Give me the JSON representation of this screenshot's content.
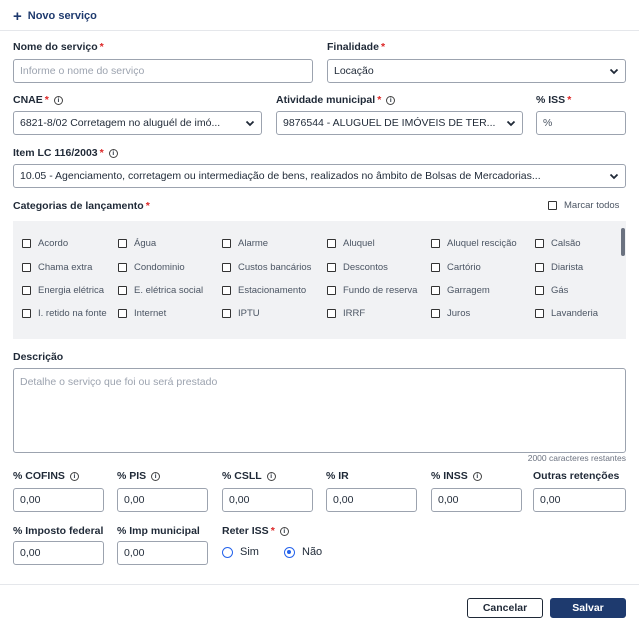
{
  "header": {
    "new_service": "Novo serviço"
  },
  "service_name": {
    "label": "Nome do serviço",
    "required": "*",
    "placeholder": "Informe o nome do serviço"
  },
  "purpose": {
    "label": "Finalidade",
    "required": " *",
    "value": "Locação"
  },
  "cnae": {
    "label": "CNAE",
    "required": "*",
    "value": "6821-8/02 Corretagem no aluguél de imó..."
  },
  "municipal_activity": {
    "label": "Atividade municipal",
    "required": "*",
    "value": "9876544 - ALUGUEL DE IMÓVEIS DE TER..."
  },
  "iss": {
    "label": "% ISS",
    "required": "*",
    "placeholder": "%"
  },
  "item_lc": {
    "label": "Item LC 116/2003",
    "required": " *",
    "value": "10.05 - Agenciamento, corretagem ou intermediação de bens, realizados no âmbito de Bolsas de Mercadorias..."
  },
  "categories": {
    "label": "Categorias de lançamento",
    "required": "*",
    "select_all": "Marcar todos",
    "items": [
      "Acordo",
      "Água",
      "Alarme",
      "Aluquel",
      "Aluquel rescição",
      "Calsão",
      "Chama extra",
      "Condominio",
      "Custos bancários",
      "Descontos",
      "Cartório",
      "Diarista",
      "Energia elétrica",
      "E. elétrica social",
      "Estacionamento",
      "Fundo de reserva",
      "Garragem",
      "Gás",
      "I. retido na fonte",
      "Internet",
      "IPTU",
      "IRRF",
      "Juros",
      "Lavanderia"
    ]
  },
  "description": {
    "label": "Descrição",
    "placeholder": "Detalhe o serviço que foi ou será prestado",
    "counter": "2000 caracteres restantes"
  },
  "taxes": [
    {
      "label": "% COFINS",
      "value": "0,00"
    },
    {
      "label": "% PIS",
      "value": "0,00"
    },
    {
      "label": "% CSLL",
      "value": "0,00"
    },
    {
      "label": "% IR",
      "value": "0,00"
    },
    {
      "label": "% INSS",
      "value": "0,00"
    },
    {
      "label": "Outras retenções",
      "value": "0,00"
    },
    {
      "label": "% Imposto federal",
      "value": "0,00"
    },
    {
      "label": "% Imp municipal",
      "value": "0,00"
    }
  ],
  "retain_iss": {
    "label": "Reter ISS",
    "required": "*",
    "yes": "Sim",
    "no": "Não",
    "selected": "Não"
  },
  "footer": {
    "cancel": "Cancelar",
    "save": "Salvar"
  },
  "colors": {
    "primary": "#1e3a6e",
    "required": "#dc2626",
    "radio": "#2563eb"
  }
}
